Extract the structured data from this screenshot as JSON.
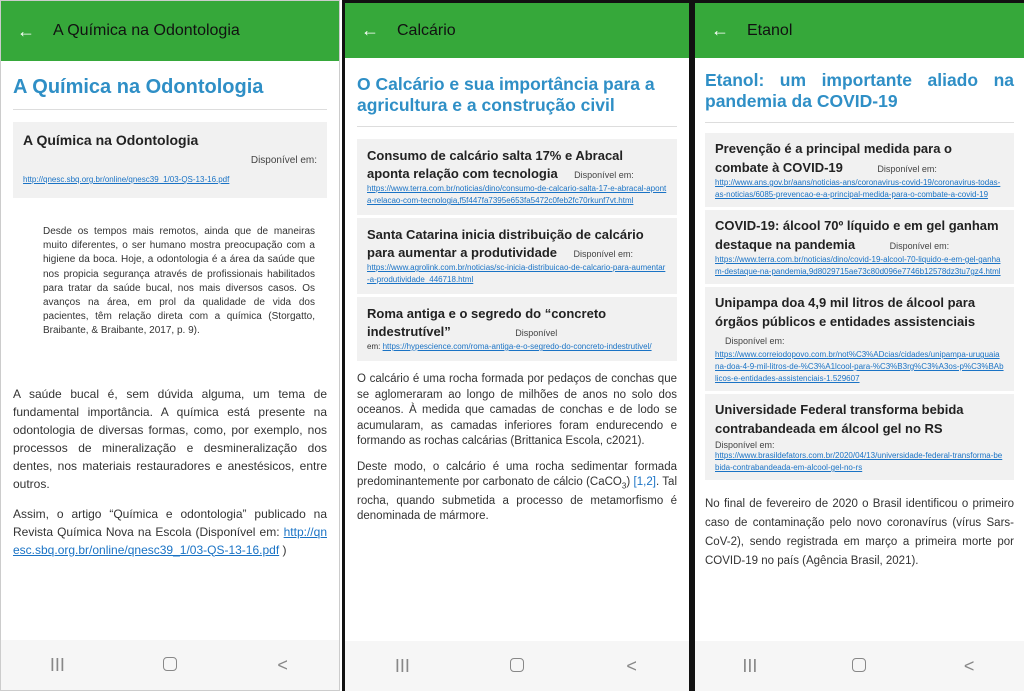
{
  "nav": {
    "recents": "III",
    "back": "<"
  },
  "panel1": {
    "appbar_title": "A Química na Odontologia",
    "heading": "A Química na Odontologia",
    "card": {
      "title": "A Química na Odontologia",
      "available": "Disponível em:",
      "link": "http://qnesc.sbq.org.br/online/qnesc39_1/03-QS-13-16.pdf"
    },
    "quote": "Desde os tempos mais remotos, ainda que de maneiras muito diferentes, o ser humano mostra preocupação com a higiene da boca. Hoje, a odontologia é a área da saúde que nos propicia segurança através de profissionais habilitados para tratar da saúde bucal, nos mais diversos casos. Os avanços na área, em prol da qualidade de vida dos pacientes, têm relação direta com a química (Storgatto, Braibante, & Braibante, 2017, p. 9).",
    "paragraph1": "A saúde bucal é, sem dúvida alguma, um tema de fundamental importância. A química está presente na odontologia de diversas formas, como, por exemplo, nos processos de mineralização e desmineralização dos dentes, nos materiais restauradores e anestésicos, entre outros.",
    "paragraph2": "Assim, o artigo “Química e odontologia” publicado na Revista Química Nova na Escola (Disponível em: ",
    "paragraph2_link": "http://qnesc.sbq.org.br/online/qnesc39_1/03-QS-13-16.pdf",
    "paragraph2_end": " )"
  },
  "panel2": {
    "appbar_title": "Calcário",
    "heading": "O Calcário e sua importância para a agricultura e a construção civil",
    "cards": [
      {
        "title": "Consumo de calcário salta 17% e Abracal aponta relação com tecnologia",
        "available": "Disponível em:",
        "link": "https://www.terra.com.br/noticias/dino/consumo-de-calcario-salta-17-e-abracal-aponta-relacao-com-tecnologia,f5f447fa7395e653fa5472c0feb2fc70rkunf7vt.html"
      },
      {
        "title": "Santa Catarina inicia distribuição de calcário para aumentar a produtividade",
        "available": "Disponível em:",
        "link": "https://www.agrolink.com.br/noticias/sc-inicia-distribuicao-de-calcario-para-aumentar-a-produtividade_446718.html"
      },
      {
        "title": "Roma antiga e o segredo do “concreto indestrutível”",
        "available": "Disponível",
        "link_prefix": "em: ",
        "link": "https://hypescience.com/roma-antiga-e-o-segredo-do-concreto-indestrutivel/"
      }
    ],
    "paragraph1": "O calcário é uma rocha formada por pedaços de conchas que se aglomeraram ao longo de milhões de anos no solo dos oceanos. À medida que camadas de conchas e de lodo se acumularam, as camadas inferiores foram endurecendo e formando as rochas calcárias (Brittanica Escola, c2021).",
    "paragraph2_a": "Deste modo, o calcário é uma rocha sedimentar formada predominantemente por carbonato de cálcio (CaCO",
    "paragraph2_sub": "3",
    "paragraph2_b": ") ",
    "paragraph2_ref": "[1,2]",
    "paragraph2_c": ". Tal rocha, quando submetida a processo de metamorfismo é denominada de mármore."
  },
  "panel3": {
    "appbar_title": "Etanol",
    "heading": "Etanol: um importante aliado na pandemia da COVID-19",
    "cards": [
      {
        "title": "Prevenção é a principal medida para o combate à COVID-19",
        "available": "Disponível em:",
        "link": "http://www.ans.gov.br/aans/noticias-ans/coronavirus-covid-19/coronavirus-todas-as-noticias/6085-prevencao-e-a-principal-medida-para-o-combate-a-covid-19"
      },
      {
        "title": "COVID-19: álcool 70º líquido e em gel ganham destaque na pandemia",
        "available": "Disponível em:",
        "link": "https://www.terra.com.br/noticias/dino/covid-19-alcool-70-liquido-e-em-gel-ganham-destaque-na-pandemia,9d8029715ae73c80d096e7746b12578dz3tu7gz4.html"
      },
      {
        "title": "Unipampa doa 4,9 mil litros de álcool para órgãos públicos e entidades assistenciais",
        "available": "Disponível em:",
        "link": "https://www.correiodopovo.com.br/not%C3%ADcias/cidades/unipampa-uruguaiana-doa-4-9-mil-litros-de-%C3%A1lcool-para-%C3%B3rg%C3%A3os-p%C3%BAblicos-e-entidades-assistenciais-1.529607"
      },
      {
        "title": "Universidade Federal transforma bebida contrabandeada em álcool gel no RS",
        "available": "Disponível em:",
        "link": "https://www.brasildefators.com.br/2020/04/13/universidade-federal-transforma-bebida-contrabandeada-em-alcool-gel-no-rs"
      }
    ],
    "paragraph1": "No final de fevereiro de 2020 o Brasil identificou o primeiro caso de contaminação pelo novo coronavírus (vírus Sars-CoV-2), sendo registrada em março a primeira morte por COVID-19 no país (Agência Brasil, 2021)."
  }
}
